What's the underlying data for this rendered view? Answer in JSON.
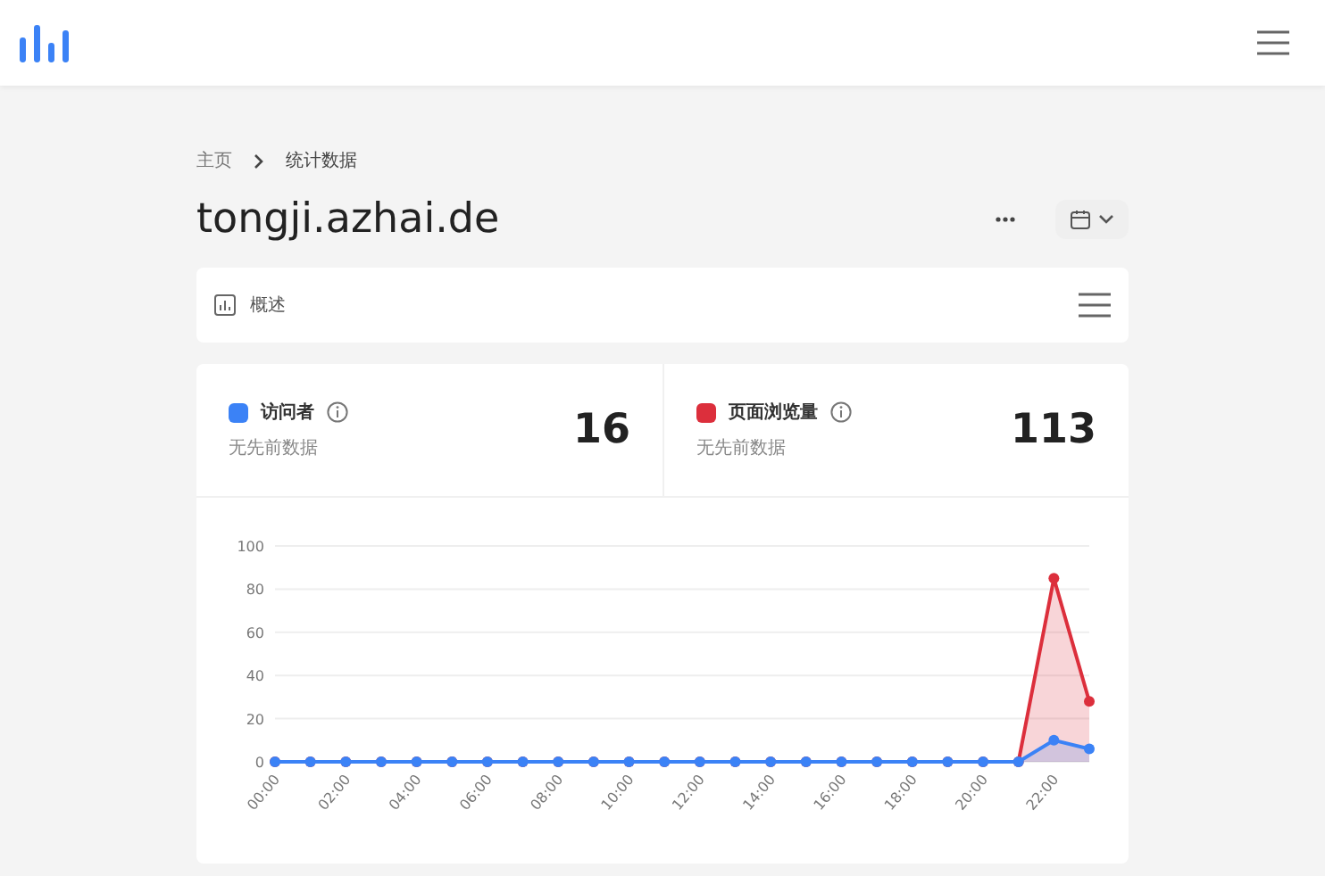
{
  "breadcrumb": [
    {
      "label": "主页"
    },
    {
      "label": "统计数据"
    }
  ],
  "site_title": "tongji.azhai.de",
  "overview_tab": {
    "label": "概述"
  },
  "stats": [
    {
      "label": "访问者",
      "color": "#3b82f6",
      "subtitle": "无先前数据",
      "value": "16"
    },
    {
      "label": "页面浏览量",
      "color": "#dc2f3c",
      "subtitle": "无先前数据",
      "value": "113"
    }
  ],
  "chart": {
    "chart_data": {
      "type": "area",
      "x": [
        0,
        1,
        2,
        3,
        4,
        5,
        6,
        7,
        8,
        9,
        10,
        11,
        12,
        13,
        14,
        15,
        16,
        17,
        18,
        19,
        20,
        21,
        22,
        23
      ],
      "series": [
        {
          "color": "#dc2f3c",
          "values": [
            0,
            0,
            0,
            0,
            0,
            0,
            0,
            0,
            0,
            0,
            0,
            0,
            0,
            0,
            0,
            0,
            0,
            0,
            0,
            0,
            0,
            0,
            85,
            28
          ]
        },
        {
          "color": "#3b82f6",
          "values": [
            0,
            0,
            0,
            0,
            0,
            0,
            0,
            0,
            0,
            0,
            0,
            0,
            0,
            0,
            0,
            0,
            0,
            0,
            0,
            0,
            0,
            0,
            10,
            6
          ]
        }
      ],
      "grid": true,
      "xlim": [
        0,
        23
      ],
      "ylim": [
        0,
        100
      ],
      "yticks": [
        0,
        20,
        40,
        60,
        80,
        100
      ],
      "xticks": [
        {
          "value": 0,
          "label": "00:00"
        },
        {
          "value": 2,
          "label": "02:00"
        },
        {
          "value": 4,
          "label": "04:00"
        },
        {
          "value": 6,
          "label": "06:00"
        },
        {
          "value": 8,
          "label": "08:00"
        },
        {
          "value": 10,
          "label": "10:00"
        },
        {
          "value": 12,
          "label": "12:00"
        },
        {
          "value": 14,
          "label": "14:00"
        },
        {
          "value": 16,
          "label": "16:00"
        },
        {
          "value": 18,
          "label": "18:00"
        },
        {
          "value": 20,
          "label": "20:00"
        },
        {
          "value": 22,
          "label": "22:00"
        }
      ]
    }
  }
}
